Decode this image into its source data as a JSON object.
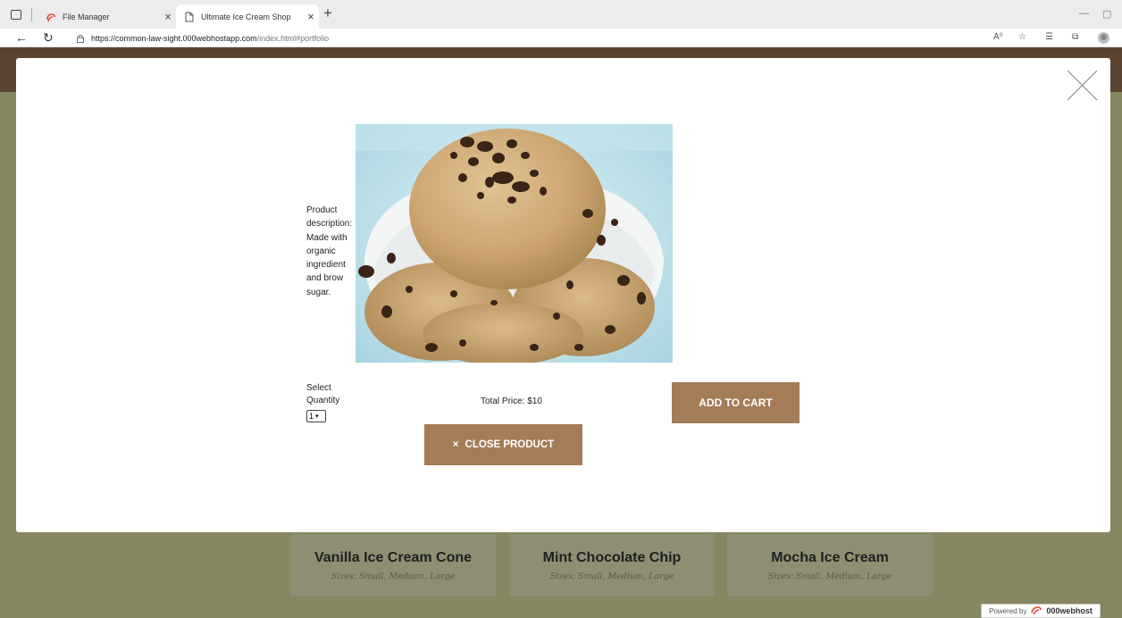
{
  "browser": {
    "tabs": [
      {
        "title": "File Manager",
        "active": false
      },
      {
        "title": "Ultimate Ice Cream Shop",
        "active": true
      }
    ],
    "new_tab_glyph": "+",
    "close_glyph": "×",
    "url_host": "https://common-law-sight.000webhostapp.com",
    "url_path": "/index.html#portfolio",
    "toolbar_icons": [
      "read-aloud-icon",
      "favorite-icon",
      "favorites-list-icon",
      "collections-icon",
      "profile-avatar"
    ]
  },
  "modal": {
    "description": "Product description: Made with organic ingredient and brow sugar.",
    "quantity_label": "Select Quantity",
    "quantity_value": "1",
    "total_price": "Total Price: $10",
    "add_to_cart_label": "ADD TO CART",
    "close_product_label": "CLOSE PRODUCT",
    "close_product_glyph": "×"
  },
  "cards": [
    {
      "title": "Vanilla Ice Cream Cone",
      "sizes": "Sizes: Small, Medium, Large"
    },
    {
      "title": "Mint Chocolate Chip",
      "sizes": "Sizes: Small, Medium, Large"
    },
    {
      "title": "Mocha Ice Cream",
      "sizes": "Sizes: Small, Medium, Large"
    }
  ],
  "footer_badge": {
    "prefix": "Powered by",
    "brand": "000webhost"
  },
  "colors": {
    "accent_button": "#a47d58",
    "page_background": "#868660",
    "header_strip": "#5b4431",
    "card_background": "#8e8e74"
  }
}
